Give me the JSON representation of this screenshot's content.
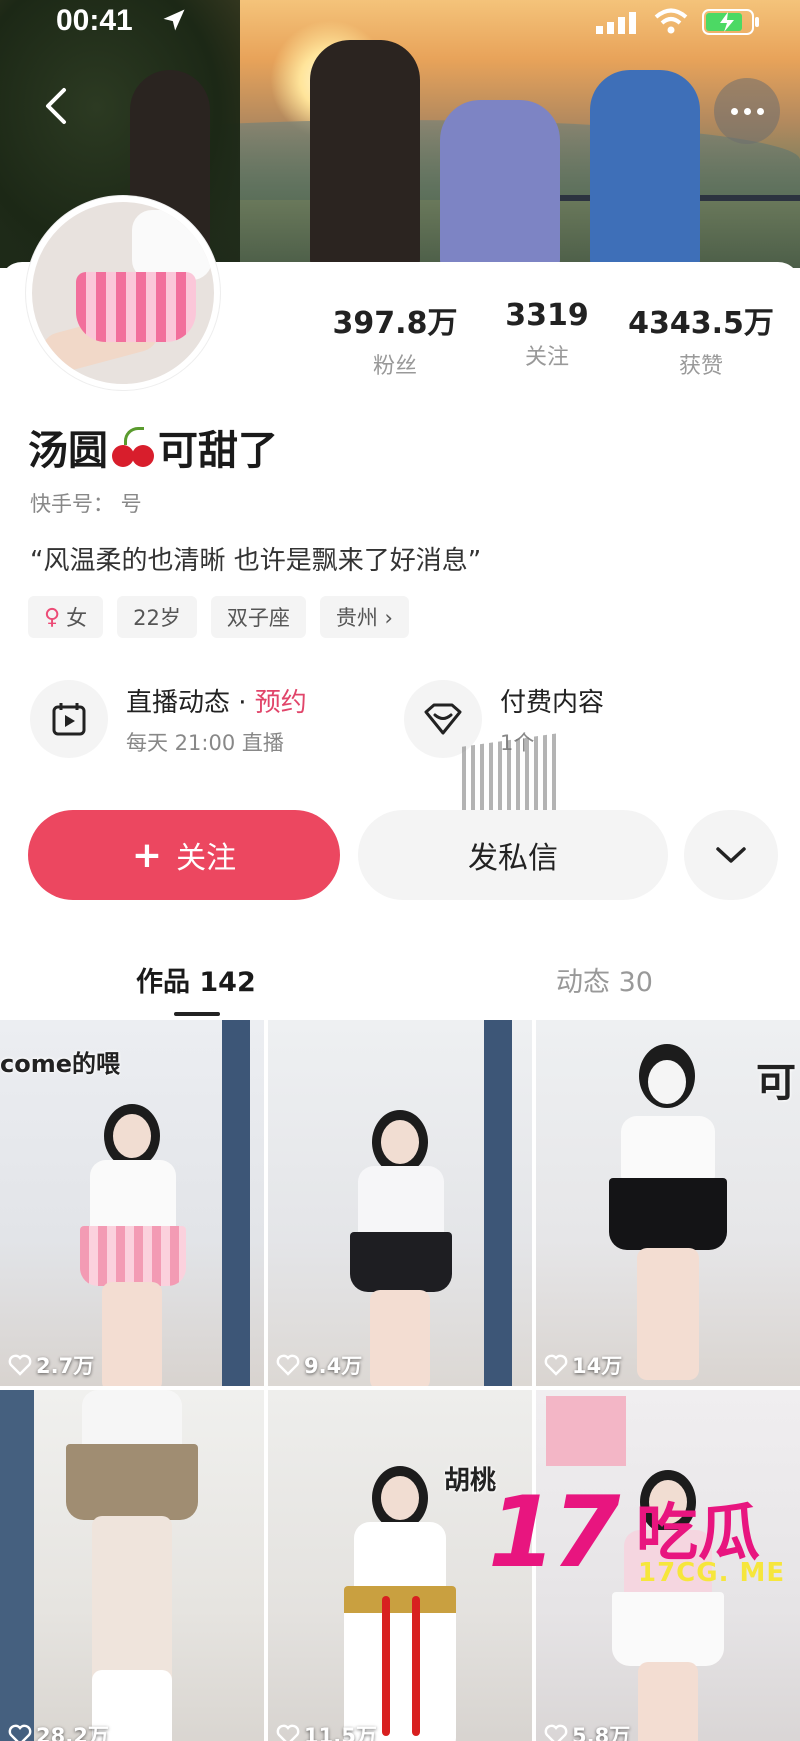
{
  "status_bar": {
    "time": "00:41"
  },
  "profile": {
    "name_part1": "汤圆",
    "name_part2": "可甜了",
    "kuaishou_id": "快手号： 号",
    "bio": "“风温柔的也清晰 也许是飘来了好消息”",
    "stats": [
      {
        "value": "397.8万",
        "label": "粉丝"
      },
      {
        "value": "3319",
        "label": "关注"
      },
      {
        "value": "4343.5万",
        "label": "获赞"
      }
    ],
    "tags": {
      "gender": "女",
      "age": "22岁",
      "zodiac": "双子座",
      "location": "贵州 ›"
    }
  },
  "features": {
    "live": {
      "title": "直播动态 · ",
      "accent": "预约",
      "subtitle": "每天 21:00 直播"
    },
    "paid": {
      "title": "付费内容",
      "subtitle": "1个"
    }
  },
  "actions": {
    "follow": "关注",
    "follow_icon": "+",
    "message": "发私信"
  },
  "tabs": {
    "works": "作品 142",
    "posts": "动态 30"
  },
  "videos": [
    {
      "likes": "2.7万",
      "overlay": "come的喂"
    },
    {
      "likes": "9.4万",
      "overlay": ""
    },
    {
      "likes": "14万",
      "overlay": "可"
    },
    {
      "likes": "28.2万",
      "overlay": ""
    },
    {
      "likes": "11.5万",
      "overlay": "胡桃"
    },
    {
      "likes": "5.8万",
      "overlay": ""
    }
  ],
  "watermark": {
    "num": "17",
    "cn": "吃瓜",
    "url": "17CG. ME"
  },
  "colors": {
    "accent": "#ec4760",
    "pink_text": "#e1456a",
    "watermark": "#e8157f",
    "watermark_url": "#f6e63c"
  }
}
